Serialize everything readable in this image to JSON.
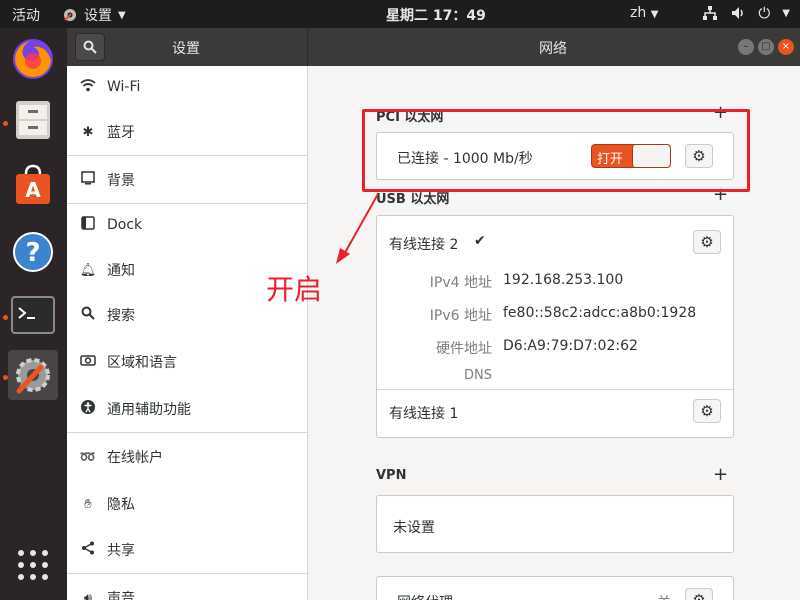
{
  "topbar": {
    "activities": "活动",
    "app_name": "设置",
    "clock": "星期二 17：49",
    "lang": "zh"
  },
  "headerbar": {
    "left_title": "设置",
    "right_title": "网络"
  },
  "sidebar": {
    "items": [
      {
        "label": "Wi-Fi",
        "icon": "wifi-icon"
      },
      {
        "label": "蓝牙",
        "icon": "bluetooth-icon"
      },
      {
        "label": "背景",
        "icon": "background-icon"
      },
      {
        "label": "Dock",
        "icon": "dock-icon"
      },
      {
        "label": "通知",
        "icon": "bell-icon"
      },
      {
        "label": "搜索",
        "icon": "search-icon"
      },
      {
        "label": "区域和语言",
        "icon": "camera-icon"
      },
      {
        "label": "通用辅助功能",
        "icon": "accessibility-icon"
      },
      {
        "label": "在线帐户",
        "icon": "online-accounts-icon"
      },
      {
        "label": "隐私",
        "icon": "hand-icon"
      },
      {
        "label": "共享",
        "icon": "share-icon"
      },
      {
        "label": "声音",
        "icon": "speaker-icon"
      }
    ]
  },
  "pci": {
    "title": "PCI 以太网",
    "status": "已连接 - 1000 Mb/秒",
    "toggle_label": "打开"
  },
  "usb": {
    "title": "USB 以太网",
    "conn2_name": "有线连接 2",
    "ipv4_key": "IPv4 地址",
    "ipv4_val": "192.168.253.100",
    "ipv6_key": "IPv6 地址",
    "ipv6_val": "fe80::58c2:adcc:a8b0:1928",
    "hw_key": "硬件地址",
    "hw_val": "D6:A9:79:D7:02:62",
    "dns_key": "DNS",
    "conn1_name": "有线连接 1"
  },
  "vpn": {
    "title": "VPN",
    "status": "未设置"
  },
  "proxy": {
    "label": "网络代理",
    "status": "关"
  },
  "annotation": {
    "text": "开启"
  },
  "colors": {
    "accent": "#e95420",
    "annotation": "#e8222a"
  }
}
